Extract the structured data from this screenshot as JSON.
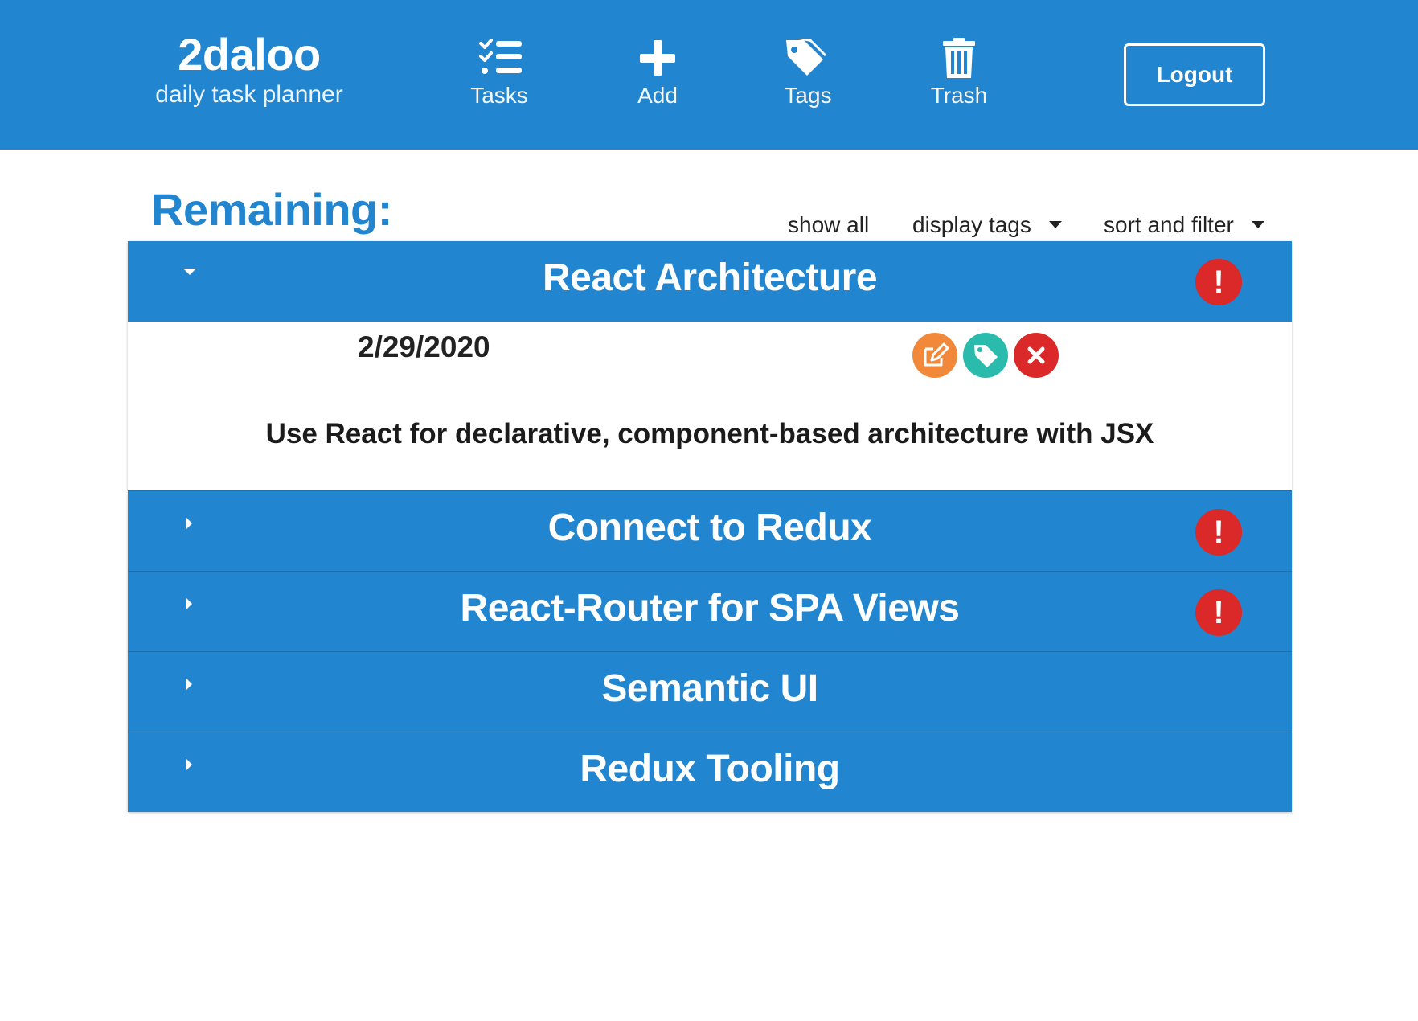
{
  "brand": {
    "title": "2daloo",
    "subtitle": "daily task planner"
  },
  "nav": [
    {
      "label": "Tasks",
      "icon": "tasks-icon"
    },
    {
      "label": "Add",
      "icon": "plus-icon"
    },
    {
      "label": "Tags",
      "icon": "tags-icon"
    },
    {
      "label": "Trash",
      "icon": "trash-icon"
    }
  ],
  "logout_label": "Logout",
  "page_title": "Remaining:",
  "controls": {
    "show_all": "show all",
    "display_tags": "display tags",
    "sort_filter": "sort and filter"
  },
  "tasks": [
    {
      "title": "React Architecture",
      "expanded": true,
      "alert": true,
      "date": "2/29/2020",
      "description": "Use React for declarative, component-based architecture with JSX"
    },
    {
      "title": "Connect to Redux",
      "expanded": false,
      "alert": true
    },
    {
      "title": "React-Router for SPA Views",
      "expanded": false,
      "alert": true
    },
    {
      "title": "Semantic UI",
      "expanded": false,
      "alert": false
    },
    {
      "title": "Redux Tooling",
      "expanded": false,
      "alert": false
    }
  ],
  "alert_glyph": "!",
  "colors": {
    "primary": "#2185d0",
    "alert": "#db2828",
    "edit": "#f2893a",
    "tag": "#2bbbad",
    "delete": "#db2828"
  }
}
